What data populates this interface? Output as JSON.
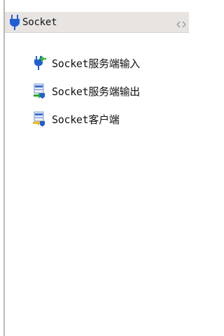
{
  "header": {
    "title": "Socket",
    "icon": "plug-icon",
    "collapse_icon": "collapse-arrows-icon"
  },
  "items": [
    {
      "label": "Socket服务端输入",
      "icon": "socket-server-input-icon"
    },
    {
      "label": "Socket服务端输出",
      "icon": "socket-server-output-icon"
    },
    {
      "label": "Socket客户端",
      "icon": "socket-client-icon"
    }
  ],
  "colors": {
    "header_bg": "#e8e4e2",
    "plug_blue": "#1f5fd6",
    "plug_green": "#2fa52f",
    "plug_yellow": "#f0b61c",
    "border": "#bdb9b2"
  }
}
